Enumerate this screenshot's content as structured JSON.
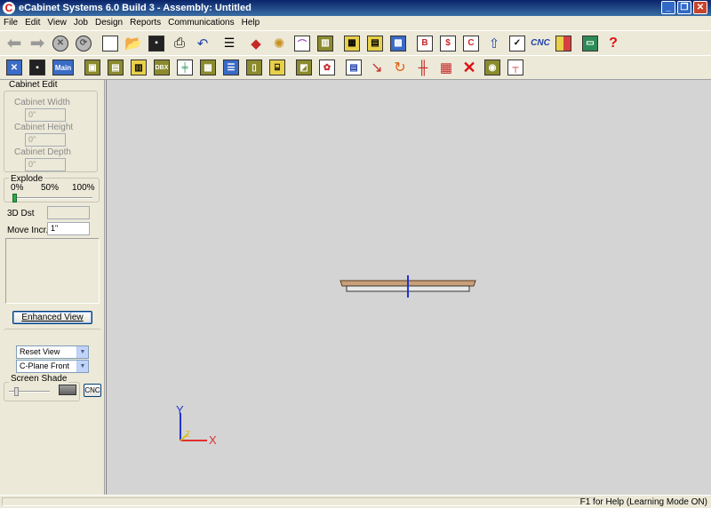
{
  "window": {
    "title": "eCabinet Systems 6.0 Build 3 - Assembly: Untitled",
    "app_icon": "C",
    "minimize": "_",
    "maximize": "❐",
    "close": "✕"
  },
  "menu": [
    "File",
    "Edit",
    "View",
    "Job",
    "Design",
    "Reports",
    "Communications",
    "Help"
  ],
  "toolbar1": {
    "cnc": "CNC",
    "help": "?"
  },
  "toolbar2": {
    "main": "Main",
    "dbx": "DBX"
  },
  "left_panel": {
    "cabinet_edit": "Cabinet Edit",
    "width_label": "Cabinet Width",
    "width_value": "0\"",
    "height_label": "Cabinet Height",
    "height_value": "0\"",
    "depth_label": "Cabinet Depth",
    "depth_value": "0\"",
    "explode_label": "Explode",
    "explode_0": "0%",
    "explode_50": "50%",
    "explode_100": "100%",
    "explode_level": 0,
    "dist_label": "3D Dst",
    "dist_value": "",
    "move_label": "Move Incr.",
    "move_value": "1\"",
    "enhanced_view": "Enhanced View",
    "reset_view": "Reset View",
    "cplane": "C-Plane Front",
    "screen_shade": "Screen Shade",
    "cnc_button": "CNC"
  },
  "axes": {
    "x": "X",
    "y": "Y",
    "z": "Z"
  },
  "colors": {
    "titlebar": "#0A246A",
    "viewport_bg": "#D4D4D4",
    "axis_x": "#E03030",
    "axis_y": "#2233CC",
    "axis_z": "#D8C020"
  },
  "status": {
    "help_text": "F1 for Help (Learning Mode ON)"
  }
}
